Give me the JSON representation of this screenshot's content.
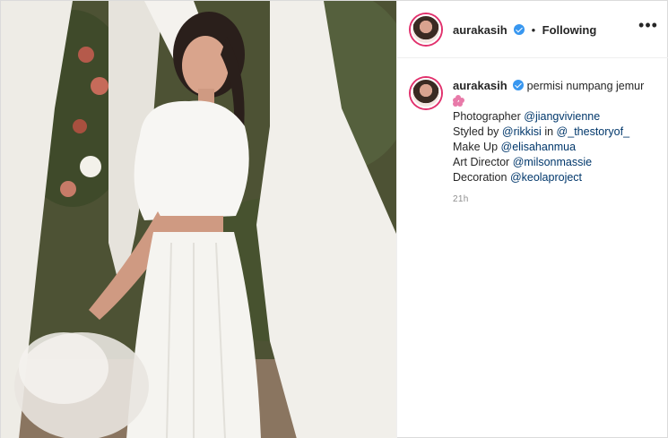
{
  "post": {
    "username": "aurakasih",
    "follow_status": "Following",
    "more_label": "•••",
    "caption": {
      "text": "permisi numpang jemur",
      "emoji": "flower-emoji",
      "lines": [
        {
          "label": "Photographer",
          "mention": "@jiangvivienne"
        },
        {
          "label": "Styled by",
          "mention": "@rikkisi",
          "middle": "in",
          "mention2": "@_thestoryof_"
        },
        {
          "label": "Make Up",
          "mention": "@elisahanmua"
        },
        {
          "label": "Art Director",
          "mention": "@milsonmassie"
        },
        {
          "label": "Decoration",
          "mention": "@keolaproject"
        }
      ]
    },
    "timestamp": "21h"
  },
  "colors": {
    "verified": "#3897f0",
    "mention": "#00376b",
    "avatar_ring": "#e1306c",
    "muted": "#8e8e8e"
  }
}
